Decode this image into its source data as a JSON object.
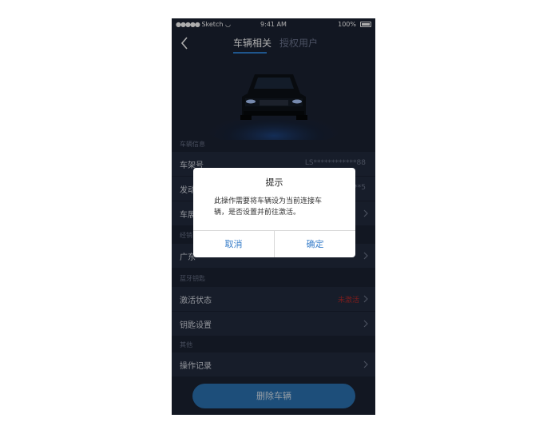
{
  "status_bar": {
    "carrier": "Sketch",
    "time": "9:41 AM",
    "battery": "100%"
  },
  "nav": {
    "tabs": [
      {
        "label": "车辆相关",
        "active": true
      },
      {
        "label": "授权用户",
        "active": false
      }
    ]
  },
  "sections": {
    "vehicle_info": "车辆信息",
    "dealer": "经销",
    "bluetooth_key": "蓝牙钥匙",
    "other": "其他"
  },
  "rows": {
    "frame_number": {
      "label": "车架号",
      "value": "LS************88"
    },
    "engine": {
      "label": "发动",
      "value": "**5"
    },
    "car_model": {
      "label": "车展"
    },
    "dealer": {
      "label": "广东"
    },
    "activation": {
      "label": "激活状态",
      "value": "未激活"
    },
    "key_settings": {
      "label": "钥匙设置"
    },
    "operation_log": {
      "label": "操作记录"
    }
  },
  "delete_button": "删除车辆",
  "dialog": {
    "title": "提示",
    "message": "此操作需要将车辆设为当前连接车辆，是否设置并前往激活。",
    "cancel": "取消",
    "confirm": "确定"
  },
  "colors": {
    "background": "#1b2233",
    "row": "#232b3e",
    "accent": "#2f7fd0",
    "button": "#2b74b4",
    "alert": "#b52b2b"
  }
}
